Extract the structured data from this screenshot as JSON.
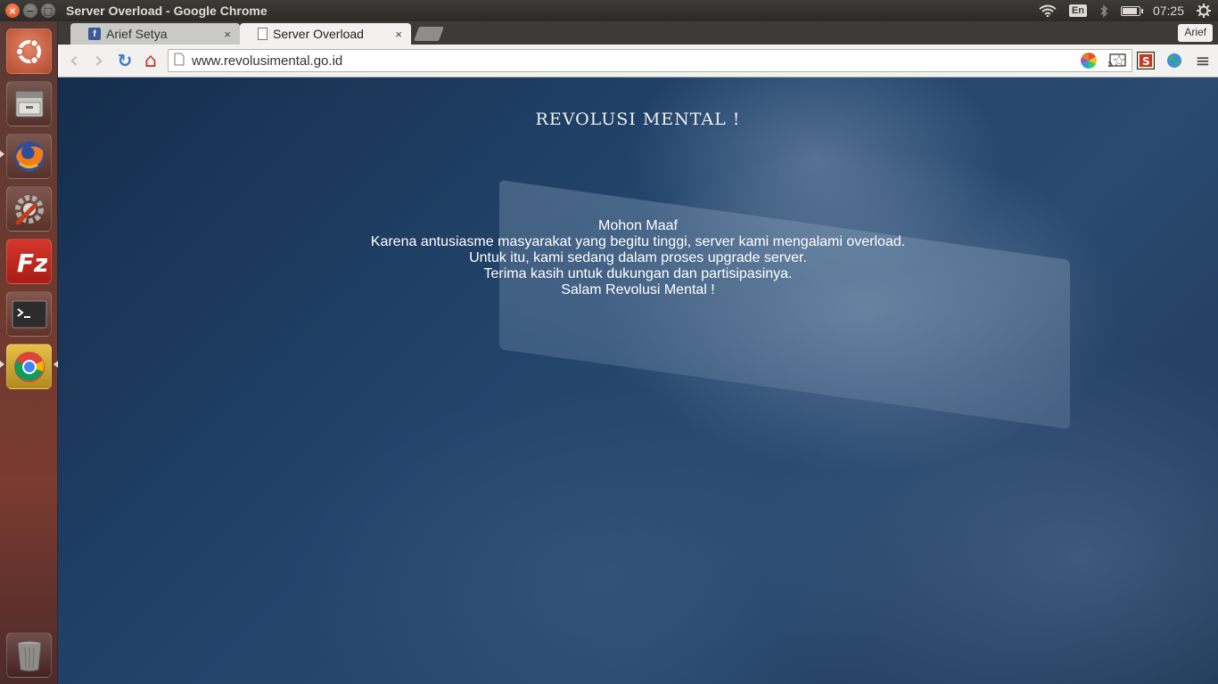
{
  "window": {
    "title": "Server Overload - Google Chrome",
    "close_glyph": "×",
    "minimize_glyph": "−",
    "maximize_glyph": "□"
  },
  "indicators": {
    "wifi_icon": "wifi-icon",
    "keyboard_lang": "En",
    "bluetooth_icon": "bluetooth-icon",
    "battery_icon": "battery-icon",
    "time": "07:25",
    "settings_icon": "gear-icon"
  },
  "launcher": {
    "items": [
      {
        "name": "ubuntu-dash-icon"
      },
      {
        "name": "files-icon"
      },
      {
        "name": "firefox-icon"
      },
      {
        "name": "system-settings-icon"
      },
      {
        "name": "filezilla-icon"
      },
      {
        "name": "terminal-icon"
      },
      {
        "name": "chrome-icon"
      },
      {
        "name": "trash-icon"
      }
    ]
  },
  "tabs": [
    {
      "label": "Arief Setya",
      "favicon": "facebook-icon",
      "favicon_glyph": "f",
      "close": "×"
    },
    {
      "label": "Server Overload",
      "favicon": "document-icon",
      "close": "×"
    }
  ],
  "profile": {
    "name": "Arief"
  },
  "toolbar": {
    "back_glyph": "‹",
    "forward_glyph": "›",
    "reload_glyph": "↻",
    "home_glyph": "⌂",
    "url": "www.revolusimental.go.id",
    "star_glyph": "☆",
    "menu_glyph": "≡"
  },
  "page": {
    "logo": "REVOLUSI MENTAL !",
    "message_lines": [
      "Mohon Maaf",
      "Karena antusiasme masyarakat yang begitu tinggi, server kami mengalami overload.",
      "Untuk itu, kami sedang dalam proses upgrade server.",
      "Terima kasih untuk dukungan dan partisipasinya.",
      "Salam Revolusi Mental !"
    ]
  },
  "colors": {
    "panel": "#3c3b37",
    "launcher": "#6e3a2e",
    "page_overlay": "#22446b",
    "text_light": "#ffffff"
  }
}
